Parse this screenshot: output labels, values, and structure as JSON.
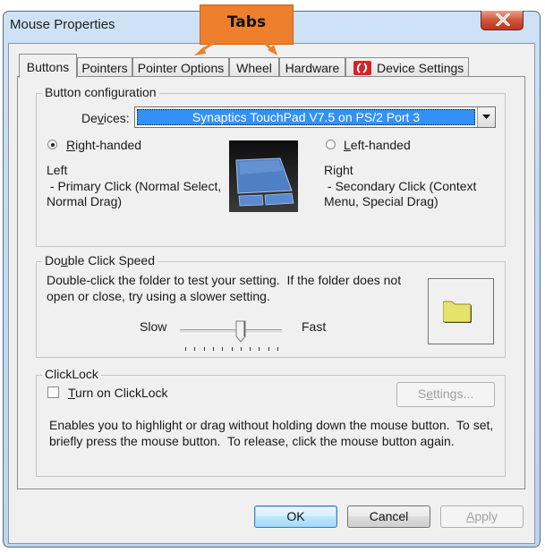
{
  "window": {
    "title": "Mouse Properties",
    "close_icon": "close-x-icon"
  },
  "annotation": {
    "label": "Tabs",
    "color": "#ee7f2d"
  },
  "tabs": [
    {
      "label": "Buttons",
      "active": true
    },
    {
      "label": "Pointers",
      "active": false
    },
    {
      "label": "Pointer Options",
      "active": false
    },
    {
      "label": "Wheel",
      "active": false
    },
    {
      "label": "Hardware",
      "active": false
    },
    {
      "label": "Device Settings",
      "active": false,
      "icon": "synaptics-icon"
    }
  ],
  "button_configuration": {
    "legend": "Button configuration",
    "devices_label_pre": "De",
    "devices_label_u": "v",
    "devices_label_post": "ices:",
    "device_selected": "Synaptics TouchPad V7.5 on PS/2 Port 3",
    "right_handed": {
      "label_u": "R",
      "label_rest": "ight-handed",
      "checked": true
    },
    "left_handed": {
      "label_u": "L",
      "label_rest": "eft-handed",
      "checked": false
    },
    "left_desc": [
      "Left",
      " - Primary Click (Normal Select,",
      "Normal Drag)"
    ],
    "right_desc": [
      "Right",
      " - Secondary Click (Context",
      "Menu, Special Drag)"
    ],
    "image": "touchpad-image"
  },
  "double_click_speed": {
    "legend_pre": "Do",
    "legend_u": "u",
    "legend_post": "ble Click Speed",
    "description": [
      "Double-click the folder to test your setting.  If the folder does not",
      "open or close, try using a slower setting."
    ],
    "slow_label": "Slow",
    "fast_label": "Fast",
    "slider_ticks": 11,
    "slider_value_index": 6,
    "folder_icon": "folder-icon"
  },
  "clicklock": {
    "legend": "ClickLock",
    "checkbox_u": "T",
    "checkbox_rest": "urn on ClickLock",
    "checked": false,
    "settings_pre": "S",
    "settings_u": "e",
    "settings_post": "ttings...",
    "description": [
      "Enables you to highlight or drag without holding down the mouse button.  To set,",
      "briefly press the mouse button.  To release, click the mouse button again."
    ]
  },
  "footer": {
    "ok": "OK",
    "cancel": "Cancel",
    "apply_u": "A",
    "apply_rest": "pply"
  }
}
